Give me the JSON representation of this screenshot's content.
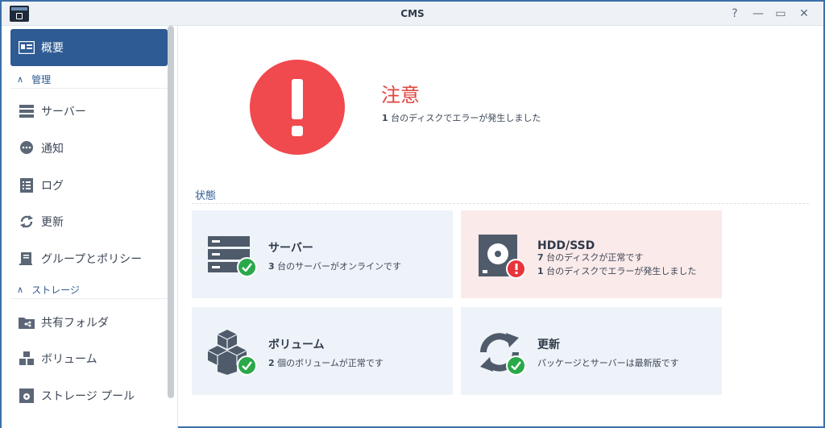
{
  "window": {
    "title": "CMS",
    "controls": {
      "help": "?",
      "minimize": "—",
      "maximize": "▭",
      "close": "✕"
    }
  },
  "sidebar": {
    "overview": {
      "label": "概要",
      "icon": "overview-card-icon"
    },
    "sections": [
      {
        "label": "管理",
        "items": [
          {
            "label": "サーバー",
            "icon": "server-icon"
          },
          {
            "label": "通知",
            "icon": "chat-bubble-icon"
          },
          {
            "label": "ログ",
            "icon": "log-list-icon"
          },
          {
            "label": "更新",
            "icon": "refresh-icon"
          },
          {
            "label": "グループとポリシー",
            "icon": "group-policy-icon"
          }
        ]
      },
      {
        "label": "ストレージ",
        "items": [
          {
            "label": "共有フォルダ",
            "icon": "shared-folder-icon"
          },
          {
            "label": "ボリューム",
            "icon": "volume-cubes-icon"
          },
          {
            "label": "ストレージ プール",
            "icon": "storage-pool-icon"
          }
        ]
      }
    ]
  },
  "alert": {
    "title": "注意",
    "count": "1",
    "message": " 台のディスクでエラーが発生しました",
    "color": "#f0494e"
  },
  "status": {
    "heading": "状態",
    "cards": [
      {
        "title": "サーバー",
        "lines": [
          {
            "count": "3",
            "text": " 台のサーバーがオンラインです"
          }
        ],
        "state": "ok"
      },
      {
        "title": "HDD/SSD",
        "lines": [
          {
            "count": "7",
            "text": " 台のディスクが正常です"
          },
          {
            "count": "1",
            "text": " 台のディスクでエラーが発生しました"
          }
        ],
        "state": "error"
      },
      {
        "title": "ボリューム",
        "lines": [
          {
            "count": "2",
            "text": " 個のボリュームが正常です"
          }
        ],
        "state": "ok"
      },
      {
        "title": "更新",
        "lines": [
          {
            "count": "",
            "text": "パッケージとサーバーは最新版です"
          }
        ],
        "state": "ok"
      }
    ]
  },
  "colors": {
    "accent": "#2e5b93",
    "ok": "#2aa84a",
    "error": "#e8343b"
  }
}
